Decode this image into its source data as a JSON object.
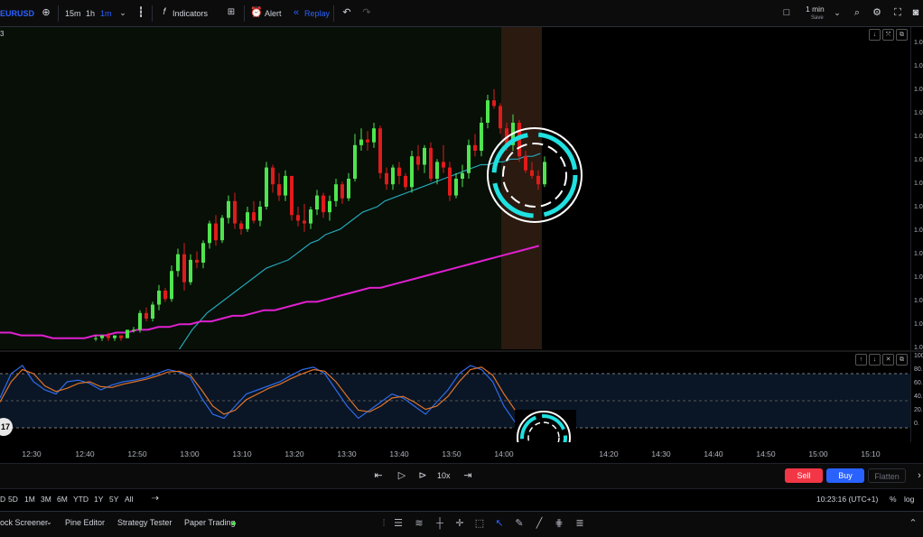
{
  "toolbar": {
    "symbol": "EURUSD",
    "intervals": [
      "15m",
      "1h",
      "1m"
    ],
    "indicators_label": "Indicators",
    "alert_label": "Alert",
    "replay_label": "Replay",
    "timeframe_label": "1 min",
    "save_label": "Save"
  },
  "chart": {
    "legend_fragment": "3",
    "price_ticks": [
      "1.0",
      "1.0",
      "1.0",
      "1.0",
      "1.0",
      "1.0",
      "1.0",
      "1.0",
      "1.0",
      "1.0",
      "1.0",
      "1.0",
      "1.0",
      "1.0"
    ],
    "oscillator_ticks": [
      "100",
      "80.",
      "60.",
      "40.",
      "20.",
      "0."
    ],
    "badge_text": "17"
  },
  "chart_data": {
    "type": "candlestick",
    "title": "",
    "xlabel": "",
    "ylabel": "",
    "x_ticks": [
      "12:30",
      "12:40",
      "12:50",
      "13:00",
      "13:10",
      "13:20",
      "13:30",
      "13:40",
      "13:50",
      "14:00",
      "14:20",
      "14:30",
      "14:40",
      "14:50",
      "15:00",
      "15:10"
    ],
    "ohlc_scale": [
      0,
      100
    ],
    "candles": [
      [
        3,
        4,
        2,
        3
      ],
      [
        3,
        4,
        2,
        4
      ],
      [
        4,
        5,
        2,
        3
      ],
      [
        3,
        4,
        2,
        4
      ],
      [
        4,
        4,
        2,
        3
      ],
      [
        3,
        6,
        3,
        6
      ],
      [
        6,
        7,
        5,
        6
      ],
      [
        6,
        13,
        5,
        12
      ],
      [
        12,
        14,
        9,
        10
      ],
      [
        10,
        16,
        9,
        15
      ],
      [
        15,
        22,
        13,
        20
      ],
      [
        20,
        21,
        16,
        17
      ],
      [
        17,
        29,
        16,
        27
      ],
      [
        27,
        35,
        25,
        33
      ],
      [
        33,
        37,
        20,
        23
      ],
      [
        23,
        33,
        22,
        31
      ],
      [
        31,
        34,
        28,
        30
      ],
      [
        30,
        38,
        28,
        37
      ],
      [
        37,
        45,
        35,
        44
      ],
      [
        44,
        47,
        36,
        38
      ],
      [
        38,
        47,
        37,
        46
      ],
      [
        46,
        54,
        44,
        52
      ],
      [
        52,
        55,
        42,
        44
      ],
      [
        44,
        45,
        40,
        42
      ],
      [
        42,
        50,
        41,
        48
      ],
      [
        48,
        52,
        44,
        45
      ],
      [
        45,
        52,
        43,
        50
      ],
      [
        50,
        66,
        49,
        64
      ],
      [
        64,
        65,
        55,
        58
      ],
      [
        58,
        62,
        52,
        54
      ],
      [
        54,
        63,
        52,
        61
      ],
      [
        61,
        60,
        45,
        47
      ],
      [
        47,
        50,
        43,
        45
      ],
      [
        45,
        51,
        41,
        44
      ],
      [
        44,
        50,
        42,
        49
      ],
      [
        49,
        56,
        47,
        54
      ],
      [
        54,
        55,
        46,
        48
      ],
      [
        48,
        54,
        45,
        52
      ],
      [
        52,
        60,
        50,
        58
      ],
      [
        58,
        59,
        51,
        53
      ],
      [
        53,
        62,
        52,
        60
      ],
      [
        60,
        76,
        59,
        72
      ],
      [
        72,
        78,
        70,
        74
      ],
      [
        74,
        77,
        70,
        73
      ],
      [
        73,
        80,
        71,
        78
      ],
      [
        78,
        79,
        60,
        62
      ],
      [
        62,
        64,
        56,
        58
      ],
      [
        58,
        65,
        56,
        64
      ],
      [
        64,
        66,
        58,
        61
      ],
      [
        61,
        62,
        56,
        57
      ],
      [
        57,
        70,
        55,
        68
      ],
      [
        68,
        72,
        63,
        65
      ],
      [
        65,
        72,
        62,
        71
      ],
      [
        71,
        73,
        59,
        60
      ],
      [
        60,
        67,
        58,
        66
      ],
      [
        66,
        72,
        62,
        64
      ],
      [
        64,
        66,
        52,
        54
      ],
      [
        54,
        62,
        53,
        60
      ],
      [
        60,
        65,
        57,
        62
      ],
      [
        62,
        74,
        60,
        72
      ],
      [
        72,
        76,
        68,
        70
      ],
      [
        70,
        82,
        68,
        80
      ],
      [
        80,
        90,
        78,
        88
      ],
      [
        88,
        92,
        85,
        86
      ],
      [
        86,
        87,
        76,
        78
      ],
      [
        78,
        80,
        70,
        72
      ],
      [
        72,
        83,
        70,
        80
      ],
      [
        80,
        81,
        66,
        68
      ],
      [
        68,
        70,
        62,
        63
      ],
      [
        63,
        66,
        60,
        61
      ],
      [
        61,
        63,
        56,
        58
      ],
      [
        58,
        68,
        57,
        66
      ]
    ],
    "series": [
      {
        "type": "line",
        "values": [
          -10,
          -6,
          -2,
          2,
          6,
          9,
          12,
          14,
          16,
          18,
          20,
          22,
          24,
          26,
          28,
          29,
          30,
          31,
          33,
          35,
          37,
          38,
          40,
          41,
          42,
          44,
          46,
          48,
          49,
          50,
          52,
          53,
          54,
          55,
          56,
          57,
          58,
          59,
          60,
          61,
          62,
          63,
          64,
          65,
          65,
          66,
          66,
          67,
          67,
          68,
          68,
          69
        ]
      },
      {
        "type": "line",
        "values": [
          5,
          5,
          4,
          4,
          4,
          3,
          3,
          3,
          3,
          4,
          4,
          5,
          5,
          6,
          6,
          7,
          7,
          8,
          8,
          9,
          9,
          10,
          11,
          11,
          12,
          13,
          13,
          14,
          15,
          16,
          16,
          17,
          18,
          19,
          20,
          21,
          21,
          22,
          23,
          24,
          25,
          26,
          27,
          28,
          29,
          30,
          31,
          32,
          33,
          34,
          35,
          36
        ]
      },
      {
        "type": "line",
        "values": [
          50,
          80,
          90,
          70,
          60,
          55,
          70,
          72,
          68,
          60,
          66,
          70,
          72,
          75,
          80,
          85,
          82,
          75,
          50,
          30,
          25,
          40,
          55,
          60,
          65,
          70,
          78,
          85,
          88,
          80,
          60,
          40,
          25,
          35,
          45,
          55,
          50,
          40,
          30,
          45,
          60,
          80,
          90,
          85,
          70,
          40,
          20,
          15,
          22
        ]
      },
      {
        "type": "line",
        "values": [
          45,
          70,
          85,
          80,
          65,
          58,
          62,
          68,
          70,
          64,
          63,
          67,
          70,
          73,
          77,
          82,
          83,
          78,
          60,
          40,
          30,
          35,
          48,
          55,
          62,
          67,
          74,
          80,
          85,
          83,
          70,
          52,
          35,
          33,
          40,
          50,
          52,
          45,
          36,
          40,
          52,
          70,
          85,
          88,
          78,
          55,
          35,
          22,
          20
        ]
      }
    ]
  },
  "timeaxis": {
    "labels": [
      "12:30",
      "12:40",
      "12:50",
      "13:00",
      "13:10",
      "13:20",
      "13:30",
      "13:40",
      "13:50",
      "14:00",
      "14:20",
      "14:30",
      "14:40",
      "14:50",
      "15:00",
      "15:10"
    ]
  },
  "replay": {
    "speed_label": "10x",
    "sell_label": "Sell",
    "buy_label": "Buy",
    "flatten_label": "Flatten",
    "sell_color": "#f23645",
    "buy_color": "#2962ff"
  },
  "ranges": {
    "items": [
      "5D",
      "1M",
      "3M",
      "6M",
      "YTD",
      "1Y",
      "5Y",
      "All"
    ],
    "first_fragment": "D",
    "time_text": "10:23:16 (UTC+1)",
    "percent_label": "%",
    "log_label": "log"
  },
  "bottom": {
    "stock_screener": "ock Screener",
    "pine_editor": "Pine Editor",
    "strategy_tester": "Strategy Tester",
    "paper_trading": "Paper Trading"
  },
  "colors": {
    "up": "#4fe44f",
    "down": "#e01b1b",
    "ma_fast": "#26a6b8",
    "ma_slow": "#e020d0",
    "stoch_k": "#2f6be8",
    "stoch_d": "#e0742a",
    "ring": "#20e0e0"
  }
}
